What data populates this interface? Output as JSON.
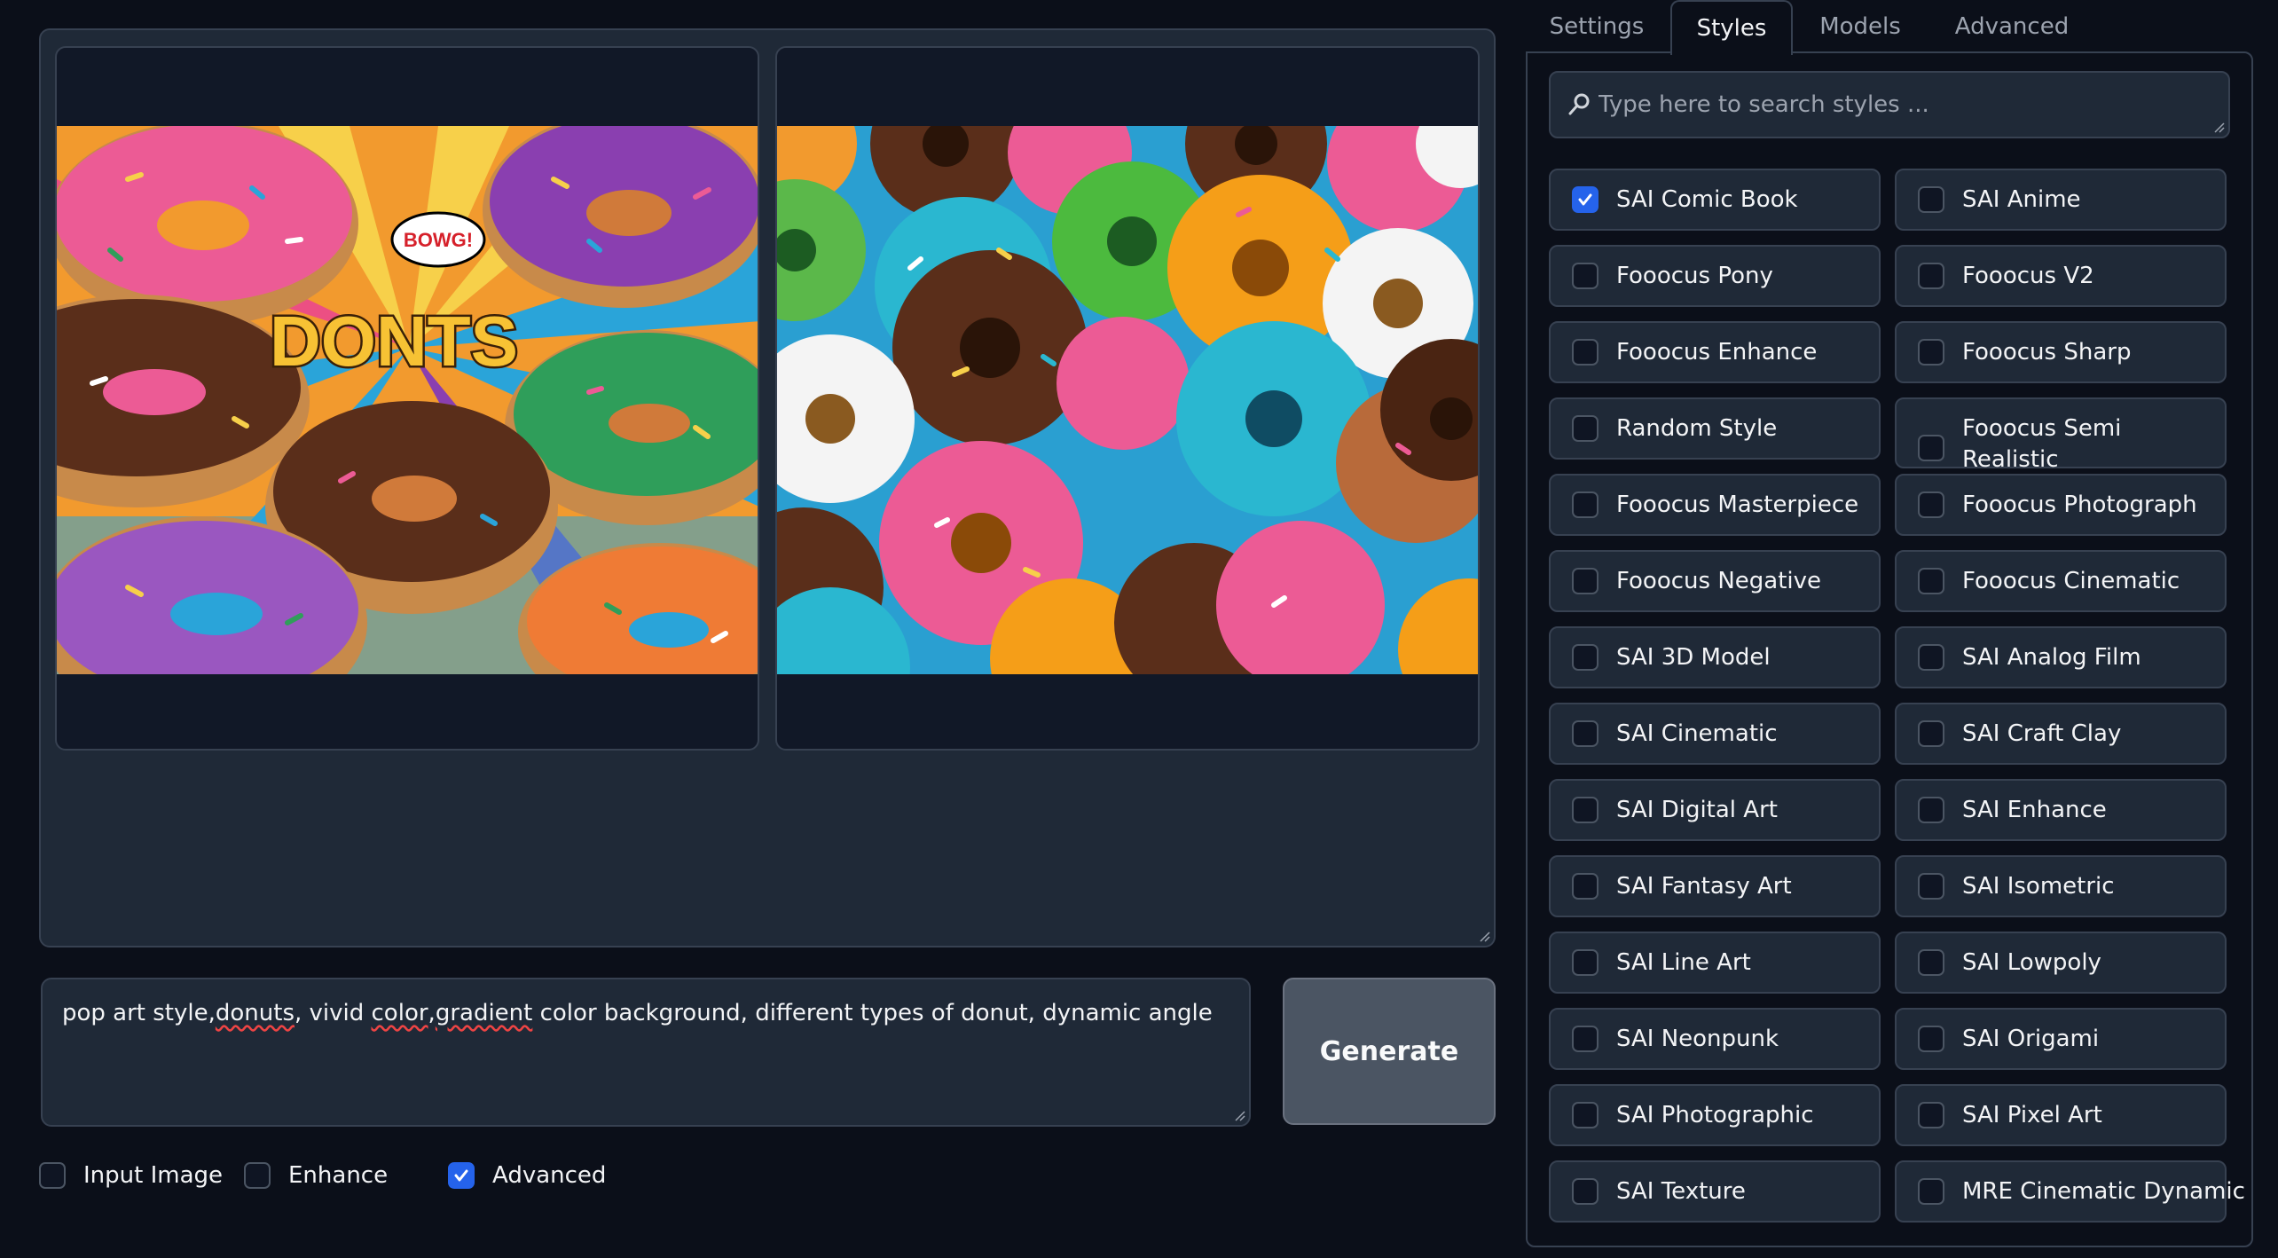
{
  "gallery": {
    "images": [
      {
        "alt": "pop art donuts comic illustration",
        "caption": "DONTS",
        "bubble": "BOWG!"
      },
      {
        "alt": "photo of colorful glazed donuts"
      }
    ]
  },
  "prompt": {
    "value_parts": [
      "pop art style,",
      "donuts",
      ", vivid ",
      "color",
      ",",
      "gradient",
      " color background, different types of donut, dynamic angle"
    ]
  },
  "generate": {
    "label": "Generate"
  },
  "options": [
    {
      "label": "Input Image",
      "checked": false
    },
    {
      "label": "Enhance",
      "checked": false
    },
    {
      "label": "Advanced",
      "checked": true
    }
  ],
  "tabs": [
    {
      "label": "Settings",
      "active": false
    },
    {
      "label": "Styles",
      "active": true
    },
    {
      "label": "Models",
      "active": false
    },
    {
      "label": "Advanced",
      "active": false
    }
  ],
  "styles": {
    "search_placeholder": "Type here to search styles ...",
    "items": [
      {
        "label": "SAI Comic Book",
        "checked": true
      },
      {
        "label": "SAI Anime",
        "checked": false
      },
      {
        "label": "Fooocus Pony",
        "checked": false
      },
      {
        "label": "Fooocus V2",
        "checked": false
      },
      {
        "label": "Fooocus Enhance",
        "checked": false
      },
      {
        "label": "Fooocus Sharp",
        "checked": false
      },
      {
        "label": "Random Style",
        "checked": false
      },
      {
        "label": "Fooocus Semi Realistic",
        "checked": false
      },
      {
        "label": "Fooocus Masterpiece",
        "checked": false
      },
      {
        "label": "Fooocus Photograph",
        "checked": false
      },
      {
        "label": "Fooocus Negative",
        "checked": false
      },
      {
        "label": "Fooocus Cinematic",
        "checked": false
      },
      {
        "label": "SAI 3D Model",
        "checked": false
      },
      {
        "label": "SAI Analog Film",
        "checked": false
      },
      {
        "label": "SAI Cinematic",
        "checked": false
      },
      {
        "label": "SAI Craft Clay",
        "checked": false
      },
      {
        "label": "SAI Digital Art",
        "checked": false
      },
      {
        "label": "SAI Enhance",
        "checked": false
      },
      {
        "label": "SAI Fantasy Art",
        "checked": false
      },
      {
        "label": "SAI Isometric",
        "checked": false
      },
      {
        "label": "SAI Line Art",
        "checked": false
      },
      {
        "label": "SAI Lowpoly",
        "checked": false
      },
      {
        "label": "SAI Neonpunk",
        "checked": false
      },
      {
        "label": "SAI Origami",
        "checked": false
      },
      {
        "label": "SAI Photographic",
        "checked": false
      },
      {
        "label": "SAI Pixel Art",
        "checked": false
      },
      {
        "label": "SAI Texture",
        "checked": false
      },
      {
        "label": "MRE Cinematic Dynamic",
        "checked": false
      }
    ]
  },
  "colors": {
    "background": "#0b0f19",
    "panel": "#1f2937",
    "border": "#374151",
    "accent": "#2563eb"
  }
}
